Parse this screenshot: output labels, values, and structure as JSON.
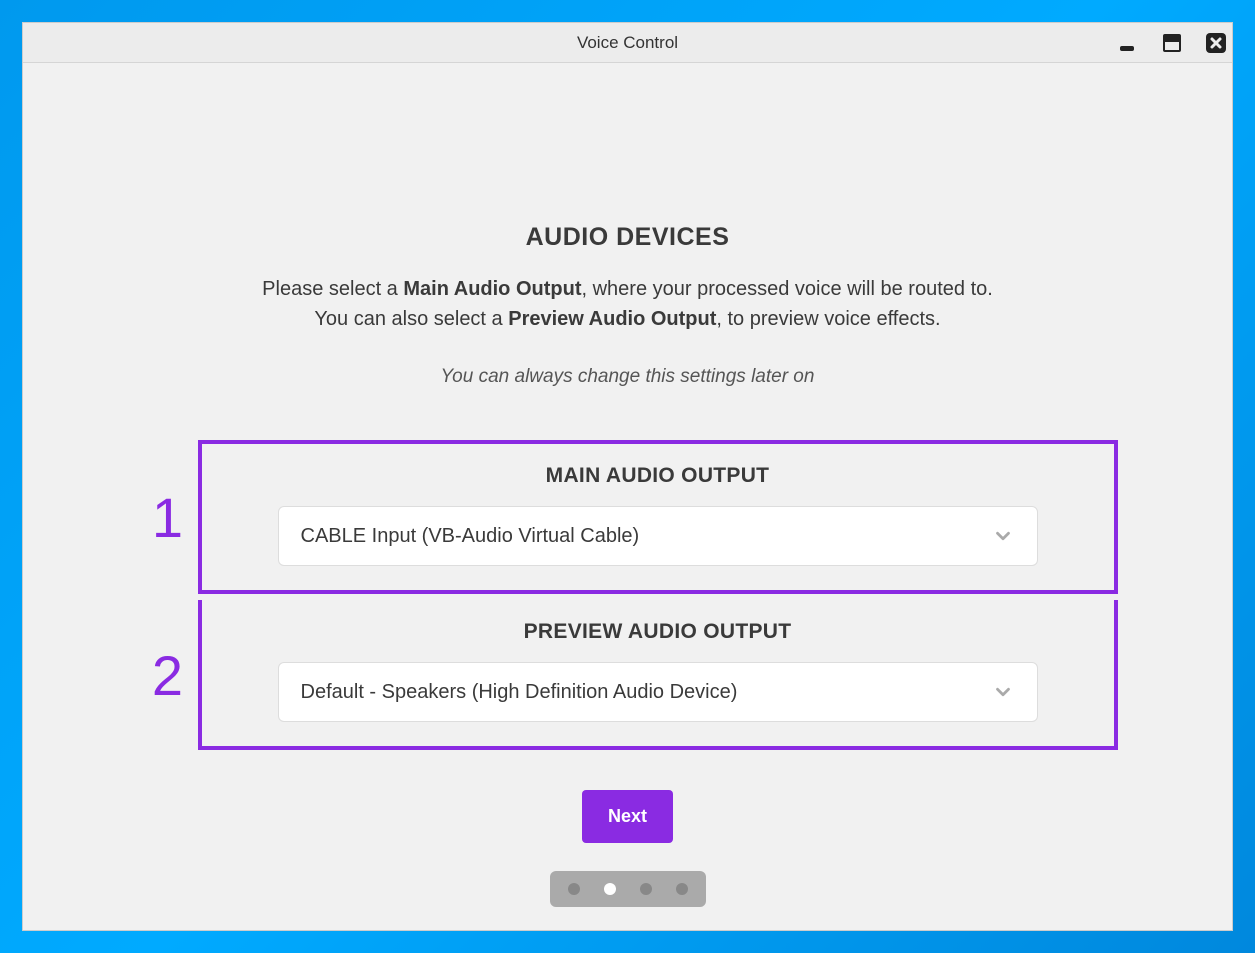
{
  "window": {
    "title": "Voice Control"
  },
  "page": {
    "heading": "AUDIO DEVICES",
    "desc_prefix1": "Please select a ",
    "desc_bold1": "Main Audio Output",
    "desc_mid1": ", where your processed voice will be routed to.",
    "desc_prefix2": "You can also select a ",
    "desc_bold2": "Preview Audio Output",
    "desc_mid2": ", to preview voice effects.",
    "hint": "You can always change this settings later on"
  },
  "panels": {
    "main": {
      "number": "1",
      "title": "MAIN AUDIO OUTPUT",
      "selected": "CABLE Input (VB-Audio Virtual Cable)"
    },
    "preview": {
      "number": "2",
      "title": "PREVIEW AUDIO OUTPUT",
      "selected": "Default - Speakers (High Definition Audio Device)"
    }
  },
  "buttons": {
    "next": "Next"
  },
  "pager": {
    "total": 4,
    "active": 2
  }
}
